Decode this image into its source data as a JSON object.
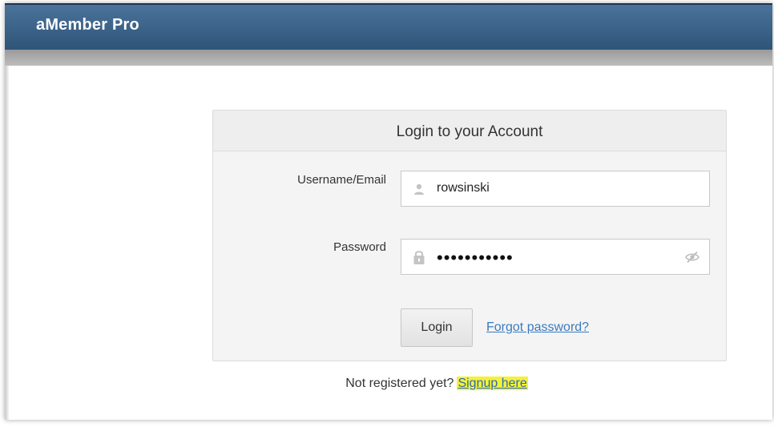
{
  "app": {
    "brand": "aMember Pro"
  },
  "login": {
    "title": "Login to your Account",
    "username_label": "Username/Email",
    "username_value": "rowsinski",
    "password_label": "Password",
    "password_mask": "•••••••••••",
    "login_button": "Login",
    "forgot_link": "Forgot password?"
  },
  "signup": {
    "prefix": "Not registered yet?",
    "link": "Signup here"
  },
  "icons": {
    "username_field": "user-icon",
    "password_field": "lock-icon",
    "password_toggle": "eye-slash-icon"
  },
  "colors": {
    "header": "#3b6388",
    "link": "#3b7bbf",
    "highlight": "#f6f03a"
  }
}
